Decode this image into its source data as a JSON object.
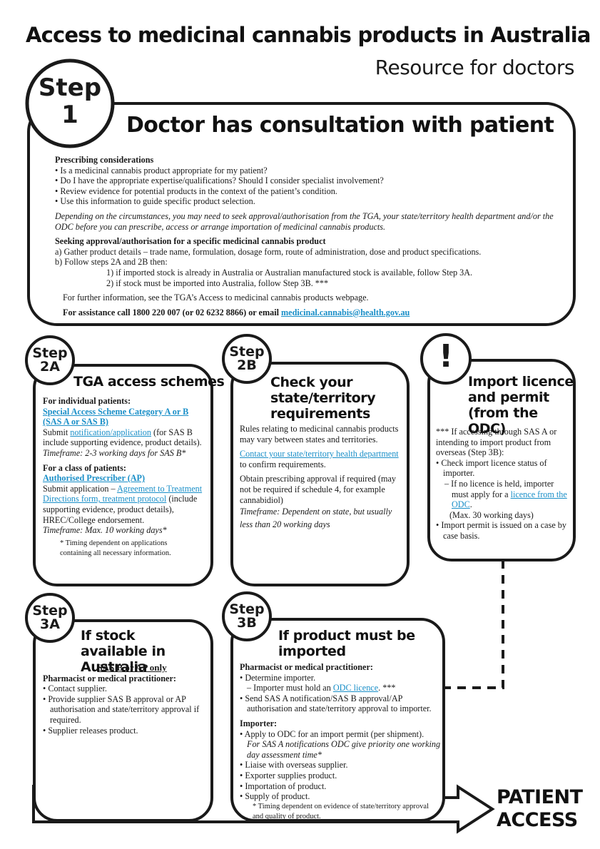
{
  "title": "Access to medicinal cannabis products in Australia",
  "subtitle": "Resource for doctors",
  "step1": {
    "badge_line1": "Step",
    "badge_line2": "1",
    "heading": "Doctor has consultation with patient",
    "considerations_title": "Prescribing considerations",
    "considerations": [
      "• Is a medicinal cannabis product appropriate for my patient?",
      "• Do I have the appropriate expertise/qualifications? Should I consider specialist involvement?",
      "• Review evidence for potential products in the context of the patient’s condition.",
      "• Use this information to guide specific product selection."
    ],
    "circumstances": "Depending on the circumstances, you may need to seek approval/authorisation from the TGA, your state/territory health department and/or the ODC before you can prescribe, access or arrange importation of medicinal cannabis products.",
    "seeking_title": "Seeking approval/authorisation for a specific medicinal cannabis product",
    "seeking_a": "a) Gather product details – trade name, formulation, dosage form, route of administration, dose and product specifications.",
    "seeking_b": "b) Follow steps 2A and 2B then:",
    "seeking_b1": "1) if imported stock is already in Australia or Australian manufactured stock is available, follow Step 3A.",
    "seeking_b2": "2) if stock must be imported into Australia, follow Step 3B. ***",
    "further_info": "For further information, see the TGA’s Access to medicinal cannabis products webpage.",
    "assistance": "For assistance call 1800 220 007 (or 02 6232 8866)  or email ",
    "email": "medicinal.cannabis@health.gov.au"
  },
  "step2a": {
    "badge_line1": "Step",
    "badge_line2": "2A",
    "heading": "TGA access schemes",
    "individual_title": "For individual patients:",
    "sas_link": "Special Access Scheme Category A or B (SAS A or SAS B)",
    "submit_pre": "Submit ",
    "submit_link": "notification/application",
    "submit_post": " (for SAS B include supporting evidence, product details).",
    "timeframe1": "Timeframe: 2-3 working days for SAS B*",
    "class_title": "For a class of patients:",
    "ap_link": "Authorised Prescriber (AP)",
    "apply_pre": "Submit application – ",
    "apply_link": "Agreement to Treatment Directions form, treatment protocol",
    "apply_post": " (include supporting evidence, product details), HREC/College endorsement.",
    "timeframe2": "Timeframe: Max. 10 working days*",
    "footnote": "* Timing dependent on applications containing all necessary information."
  },
  "step2b": {
    "badge_line1": "Step",
    "badge_line2": "2B",
    "heading": "Check your state/territory requirements",
    "rules": "Rules relating to medicinal cannabis products may vary between states and territories.",
    "contact_link": "Contact your state/territory health department",
    "contact_post": "  to confirm requirements.",
    "obtain": "Obtain prescribing approval if required (may not be required if schedule 4, for example cannabidiol)",
    "timeframe": "Timeframe: Dependent on state, but usually less than 20 working days"
  },
  "import": {
    "badge": "!",
    "heading": "Import licence and permit (from the ODC)",
    "intro": "*** If accessing through SAS A or intending to import product from overseas (Step 3B):",
    "check": "• Check import licence status of importer.",
    "no_licence_pre": "– If no licence is held, importer must apply for a ",
    "no_licence_link": "licence from the ODC",
    "no_licence_post": ".",
    "max": "(Max. 30 working days)",
    "permit": "• Import permit is issued on a case by case basis."
  },
  "step3a": {
    "badge_line1": "Step",
    "badge_line2": "3A",
    "heading": "If stock available in Australia",
    "only": "SAS B or AP only",
    "who": "Pharmacist or medical practitioner:",
    "items": [
      "• Contact supplier.",
      "• Provide supplier SAS B approval or AP authorisation and state/territory approval if required.",
      "• Supplier releases product."
    ]
  },
  "step3b": {
    "badge_line1": "Step",
    "badge_line2": "3B",
    "heading": "If product must be imported",
    "who": "Pharmacist or medical practitioner:",
    "determine": "• Determine importer.",
    "hold_pre": "– Importer must hold an ",
    "hold_link": "ODC licence",
    "hold_post": ". ***",
    "send": "• Send SAS A notification/SAS B approval/AP authorisation and state/territory approval to importer.",
    "importer_title": "Importer:",
    "apply": "• Apply to ODC for an import permit (per shipment).",
    "apply_note": "For SAS A notifications ODC give priority one working day assessment time*",
    "items": [
      "• Liaise with overseas supplier.",
      "• Exporter supplies product.",
      "• Importation of product.",
      "• Supply of product."
    ],
    "footnote": "* Timing dependent on evidence of state/territory approval and quality of product."
  },
  "patient_access": {
    "line1": "PATIENT",
    "line2": "ACCESS"
  },
  "colors": {
    "link": "#1a8fc8",
    "outline": "#1a1a1a"
  }
}
